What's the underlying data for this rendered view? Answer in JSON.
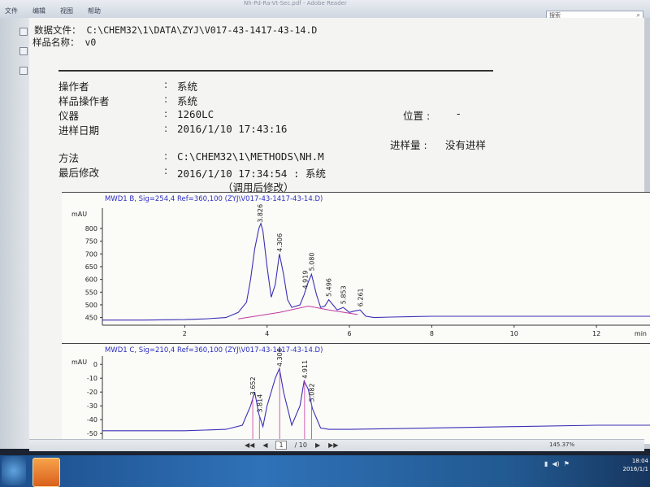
{
  "window": {
    "title": "Nh-Pd-Ra-Vt-Sec.pdf - Adobe Reader",
    "menu": [
      "文件",
      "编辑",
      "视图",
      "帮助"
    ],
    "search_placeholder": "搜索",
    "page_current": "1",
    "page_total": "/ 10",
    "zoom": "145.37%",
    "clock_time": "18:04",
    "clock_date": "2016/1/1"
  },
  "report": {
    "data_file_label": "数据文件：",
    "data_file_value": "C:\\CHEM32\\1\\DATA\\ZYJ\\V017-43-1417-43-14.D",
    "sample_name_label": "样品名称：",
    "sample_name_value": "v0",
    "fields": [
      {
        "label": "操作者",
        "value": "系统"
      },
      {
        "label": "样品操作者",
        "value": "系统"
      },
      {
        "label": "仪器",
        "value": "1260LC"
      },
      {
        "label": "进样日期",
        "value": "2016/1/10 17:43:16"
      },
      {
        "label": "方法",
        "value": "C:\\CHEM32\\1\\METHODS\\NH.M"
      },
      {
        "label": "最后修改",
        "value": "2016/1/10 17:34:54 : 系统"
      }
    ],
    "colon": ":",
    "modified_note": "（调用后修改）",
    "position_label": "位置 :",
    "position_value": "-",
    "inj_vol_label": "进样量 :",
    "inj_vol_value": "没有进样"
  },
  "chart_data": [
    {
      "type": "line",
      "title": "MWD1 B, Sig=254,4 Ref=360,100 (ZYJ\\V017-43-1417-43-14.D)",
      "ylabel": "mAU",
      "xlabel": "min",
      "yticks": [
        450,
        500,
        550,
        600,
        650,
        700,
        750,
        800
      ],
      "xticks": [
        2,
        4,
        6,
        8,
        10,
        12
      ],
      "xlim": [
        0,
        13.3
      ],
      "ylim": [
        420,
        880
      ],
      "peak_labels": [
        {
          "rt": 3.826,
          "label": "3.826"
        },
        {
          "rt": 4.306,
          "label": "4.306"
        },
        {
          "rt": 4.919,
          "label": "4.919"
        },
        {
          "rt": 5.08,
          "label": "5.080"
        },
        {
          "rt": 5.496,
          "label": "5.496"
        },
        {
          "rt": 5.853,
          "label": "5.853"
        },
        {
          "rt": 6.261,
          "label": "6.261"
        }
      ],
      "x": [
        0,
        1,
        2,
        2.5,
        3,
        3.3,
        3.5,
        3.6,
        3.7,
        3.8,
        3.85,
        3.9,
        4.0,
        4.1,
        4.2,
        4.3,
        4.4,
        4.5,
        4.6,
        4.8,
        4.9,
        5.0,
        5.08,
        5.2,
        5.3,
        5.4,
        5.5,
        5.6,
        5.7,
        5.85,
        6.0,
        6.1,
        6.26,
        6.4,
        6.6,
        7,
        8,
        9,
        10,
        11,
        12,
        13.3
      ],
      "y": [
        440,
        440,
        442,
        445,
        450,
        470,
        510,
        600,
        720,
        800,
        820,
        790,
        650,
        530,
        580,
        700,
        620,
        520,
        490,
        500,
        540,
        590,
        620,
        540,
        490,
        495,
        520,
        500,
        480,
        490,
        470,
        475,
        480,
        455,
        450,
        452,
        455,
        455,
        455,
        455,
        455,
        455
      ],
      "baseline_x": [
        3.3,
        4.3,
        5.0,
        5.5,
        6.2
      ],
      "baseline_y": [
        445,
        470,
        495,
        480,
        462
      ],
      "colors": {
        "signal": "#3b2fb5",
        "baseline": "#c23aa0",
        "title": "#2c2ec0"
      }
    },
    {
      "type": "line",
      "title": "MWD1 C, Sig=210,4 Ref=360,100 (ZYJ\\V017-43-1417-43-14.D)",
      "ylabel": "mAU",
      "yticks": [
        0,
        -10,
        -20,
        -30,
        -40,
        -50
      ],
      "xlim": [
        0,
        13.3
      ],
      "ylim": [
        -54,
        6
      ],
      "peak_labels": [
        {
          "rt": 3.652,
          "label": "3.652"
        },
        {
          "rt": 3.814,
          "label": "3.814"
        },
        {
          "rt": 4.306,
          "label": "4.306"
        },
        {
          "rt": 4.911,
          "label": "4.911"
        },
        {
          "rt": 5.082,
          "label": "5.082"
        }
      ],
      "x": [
        0,
        2,
        3,
        3.4,
        3.6,
        3.7,
        3.8,
        3.9,
        4.0,
        4.2,
        4.3,
        4.4,
        4.6,
        4.8,
        4.9,
        5.0,
        5.1,
        5.3,
        5.5,
        6,
        8,
        10,
        12,
        13.3
      ],
      "y": [
        -48,
        -48,
        -47,
        -44,
        -30,
        -20,
        -36,
        -45,
        -30,
        -10,
        -3,
        -20,
        -44,
        -30,
        -12,
        -18,
        -32,
        -46,
        -47,
        -47,
        -46,
        -45,
        -44,
        -44
      ],
      "colors": {
        "signal": "#3b2fb5",
        "baseline": "#c23aa0",
        "title": "#2c2ec0"
      }
    }
  ]
}
